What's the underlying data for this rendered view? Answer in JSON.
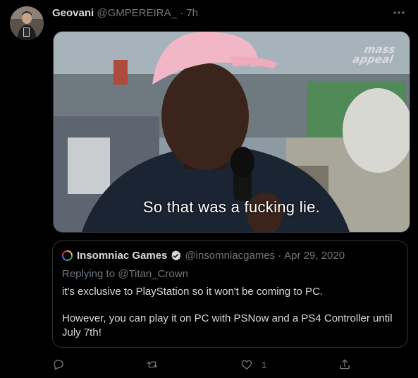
{
  "tweet": {
    "display_name": "Geovani",
    "handle": "@GMPEREIRA_",
    "separator": "·",
    "time": "7h",
    "media": {
      "caption": "So that was a fucking lie.",
      "watermark_line1": "mass",
      "watermark_line2": "appeal"
    },
    "quoted": {
      "display_name": "Insomniac Games",
      "handle": "@insomniacgames",
      "separator": "·",
      "date": "Apr 29, 2020",
      "replying_prefix": "Replying to",
      "replying_to": "@Titan_Crown",
      "paragraph1": "it's exclusive to PlayStation so it won't be coming to PC.",
      "paragraph2": "However, you can play it on PC with PSNow and a PS4 Controller until July 7th!"
    },
    "actions": {
      "reply_count": "",
      "retweet_count": "",
      "like_count": "1"
    }
  },
  "icons": [
    "more-icon",
    "verified-icon",
    "reply-icon",
    "retweet-icon",
    "like-icon",
    "share-icon"
  ],
  "colors": {
    "background": "#000000",
    "text": "#d9d9d9",
    "muted": "#6e767d",
    "border": "#2f3336",
    "verified": "#d9d9d9"
  }
}
